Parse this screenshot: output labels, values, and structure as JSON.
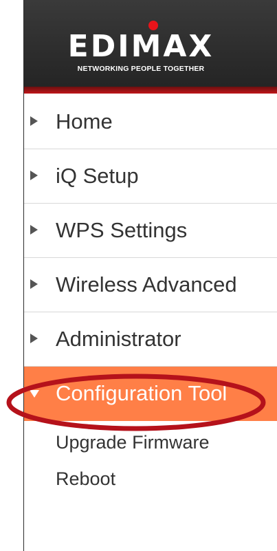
{
  "brand": {
    "name": "EDIMAX",
    "tagline": "NETWORKING PEOPLE TOGETHER"
  },
  "menu": {
    "items": [
      {
        "label": "Home"
      },
      {
        "label": "iQ Setup"
      },
      {
        "label": "WPS Settings"
      },
      {
        "label": "Wireless Advanced"
      },
      {
        "label": "Administrator"
      },
      {
        "label": "Configuration Tool",
        "expanded": true,
        "highlighted": true
      }
    ],
    "subitems": [
      {
        "label": "Upgrade Firmware"
      },
      {
        "label": "Reboot"
      }
    ]
  },
  "colors": {
    "active_bg": "#ff7f47",
    "header_bg": "#2d2d2d",
    "header_stripe": "#c0161a",
    "highlight_ring": "#b5121b",
    "logo_dot": "#e8141a"
  },
  "icons": {
    "collapsed": "triangle-right-icon",
    "expanded": "triangle-down-icon"
  }
}
